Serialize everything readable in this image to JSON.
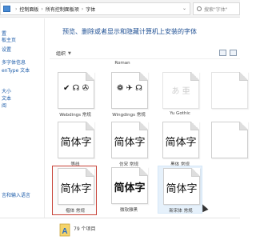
{
  "address_bar": {
    "breadcrumbs": [
      "控制面板",
      "所有控制面板项",
      "字体"
    ],
    "search_placeholder": "搜索\"字体\""
  },
  "nav": {
    "items": [
      "置",
      "板主页",
      "设置",
      "多字体信息",
      "enType 文本",
      "大小",
      "文本",
      "阅"
    ],
    "bottom_item": "言和输入语言"
  },
  "main": {
    "heading": "预览、删除或者显示和隐藏计算机上安装的字体",
    "organize_label": "组织",
    "organize_arrow": "▼",
    "top_partial_label": "Roman"
  },
  "fonts": [
    {
      "glyphs": "✔ ☊ ✇",
      "label": "Webdings 常规"
    },
    {
      "glyphs": "❁ ✈ ☊",
      "label": "Wingdings 常规"
    },
    {
      "glyphs": "あ 亜",
      "label": "Yu Gothic"
    },
    {
      "glyphs": "",
      "label": ""
    },
    {
      "glyphs": "简体字",
      "label": "等线"
    },
    {
      "glyphs": "简体字",
      "label": "仿宋 常规"
    },
    {
      "glyphs": "简体字",
      "label": "黑体 常规"
    },
    {
      "glyphs": "",
      "label": ""
    },
    {
      "glyphs": "简体字",
      "label": "楷体 常规"
    },
    {
      "glyphs": "简体字",
      "label": "微软雅黑"
    },
    {
      "glyphs": "简体字",
      "label": "新宋体 常规"
    }
  ],
  "status": {
    "count_text": "79 个项目"
  },
  "colors": {
    "heading": "#1e4f93",
    "selection_border": "#c9453a",
    "hover_background": "#e6f1fb"
  }
}
